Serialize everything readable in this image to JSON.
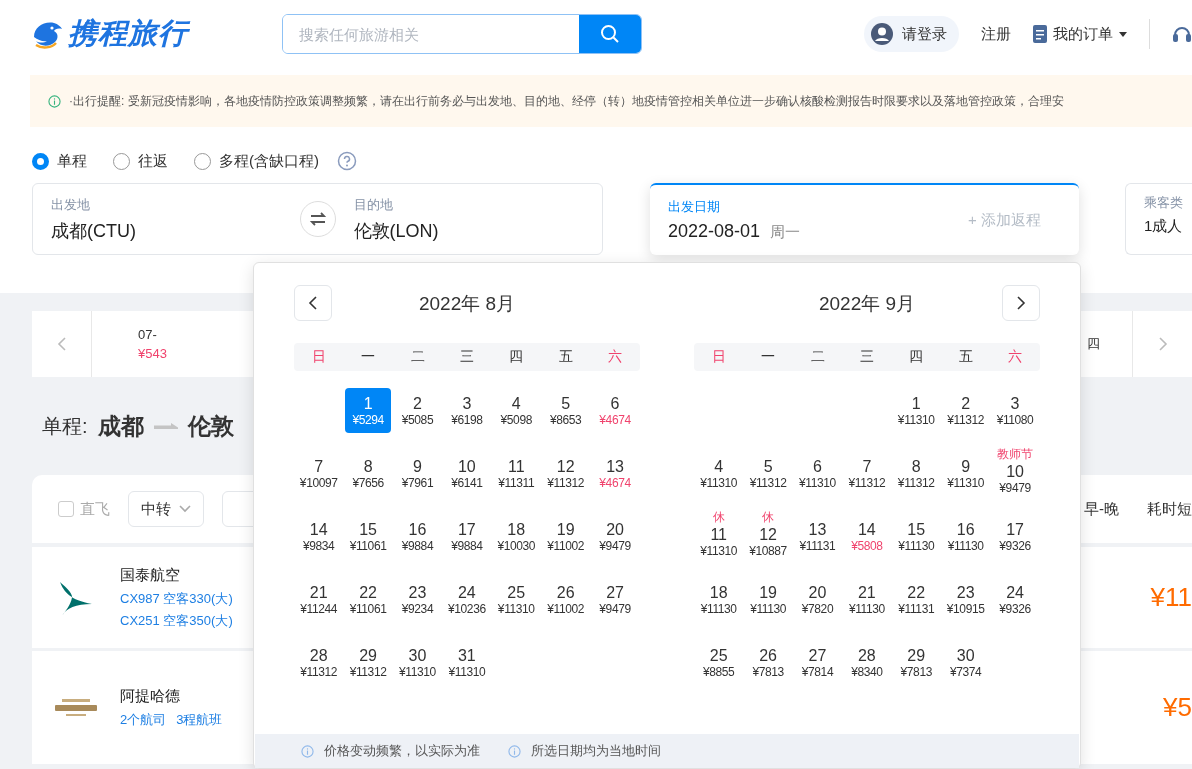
{
  "header": {
    "logo": "携程旅行",
    "search": {
      "placeholder": "搜索任何旅游相关"
    },
    "login": "请登录",
    "register": "注册",
    "orders": "我的订单"
  },
  "notice": "·出行提醒: 受新冠疫情影响，各地疫情防控政策调整频繁，请在出行前务必与出发地、目的地、经停（转）地疫情管控相关单位进一步确认核酸检测报告时限要求以及落地管控政策，合理安",
  "trip_types": [
    {
      "label": "单程",
      "selected": true
    },
    {
      "label": "往返",
      "selected": false
    },
    {
      "label": "多程(含缺口程)",
      "selected": false
    }
  ],
  "search_form": {
    "from": {
      "label": "出发地",
      "value": "成都(CTU)"
    },
    "to": {
      "label": "目的地",
      "value": "伦敦(LON)"
    },
    "date": {
      "label": "出发日期",
      "value": "2022-08-01",
      "weekday": "周一",
      "add_return": "+ 添加返程"
    },
    "passenger": {
      "label": "乘客类",
      "value": "1成人"
    }
  },
  "date_strip": {
    "first_date": "07-",
    "first_price": "¥543",
    "last_label": "四"
  },
  "route": {
    "label": "单程:",
    "from": "成都",
    "to": "伦敦"
  },
  "filters": {
    "direct": {
      "label": "直飞",
      "checked": false
    },
    "transfer": "中转",
    "sorts": [
      "早-晚",
      "耗时短"
    ]
  },
  "flights": [
    {
      "airline": "国泰航空",
      "lines": [
        "CX987 空客330(大)",
        "CX251 空客350(大)"
      ],
      "price": "¥11"
    },
    {
      "airline": "阿提哈德",
      "lines": [
        "2个航司",
        "3程航班"
      ],
      "price": "¥5"
    }
  ],
  "calendar": {
    "months": [
      {
        "title": "2022年 8月",
        "has_prev": true,
        "has_next": false,
        "weekdays": [
          "日",
          "一",
          "二",
          "三",
          "四",
          "五",
          "六"
        ],
        "days": [
          {
            "kind": "blank"
          },
          {
            "kind": "day",
            "day": "1",
            "price": "¥5294",
            "low": false,
            "selected": true
          },
          {
            "kind": "day",
            "day": "2",
            "price": "¥5085",
            "low": false,
            "selected": false
          },
          {
            "kind": "day",
            "day": "3",
            "price": "¥6198",
            "low": false,
            "selected": false
          },
          {
            "kind": "day",
            "day": "4",
            "price": "¥5098",
            "low": false,
            "selected": false
          },
          {
            "kind": "day",
            "day": "5",
            "price": "¥8653",
            "low": false,
            "selected": false
          },
          {
            "kind": "day",
            "day": "6",
            "price": "¥4674",
            "low": true,
            "selected": false
          },
          {
            "kind": "day",
            "day": "7",
            "price": "¥10097",
            "low": false,
            "selected": false
          },
          {
            "kind": "day",
            "day": "8",
            "price": "¥7656",
            "low": false,
            "selected": false
          },
          {
            "kind": "day",
            "day": "9",
            "price": "¥7961",
            "low": false,
            "selected": false
          },
          {
            "kind": "day",
            "day": "10",
            "price": "¥6141",
            "low": false,
            "selected": false
          },
          {
            "kind": "day",
            "day": "11",
            "price": "¥11311",
            "low": false,
            "selected": false
          },
          {
            "kind": "day",
            "day": "12",
            "price": "¥11312",
            "low": false,
            "selected": false
          },
          {
            "kind": "day",
            "day": "13",
            "price": "¥4674",
            "low": true,
            "selected": false
          },
          {
            "kind": "day",
            "day": "14",
            "price": "¥9834",
            "low": false,
            "selected": false
          },
          {
            "kind": "day",
            "day": "15",
            "price": "¥11061",
            "low": false,
            "selected": false
          },
          {
            "kind": "day",
            "day": "16",
            "price": "¥9884",
            "low": false,
            "selected": false
          },
          {
            "kind": "day",
            "day": "17",
            "price": "¥9884",
            "low": false,
            "selected": false
          },
          {
            "kind": "day",
            "day": "18",
            "price": "¥10030",
            "low": false,
            "selected": false
          },
          {
            "kind": "day",
            "day": "19",
            "price": "¥11002",
            "low": false,
            "selected": false
          },
          {
            "kind": "day",
            "day": "20",
            "price": "¥9479",
            "low": false,
            "selected": false
          },
          {
            "kind": "day",
            "day": "21",
            "price": "¥11244",
            "low": false,
            "selected": false
          },
          {
            "kind": "day",
            "day": "22",
            "price": "¥11061",
            "low": false,
            "selected": false
          },
          {
            "kind": "day",
            "day": "23",
            "price": "¥9234",
            "low": false,
            "selected": false
          },
          {
            "kind": "day",
            "day": "24",
            "price": "¥10236",
            "low": false,
            "selected": false
          },
          {
            "kind": "day",
            "day": "25",
            "price": "¥11310",
            "low": false,
            "selected": false
          },
          {
            "kind": "day",
            "day": "26",
            "price": "¥11002",
            "low": false,
            "selected": false
          },
          {
            "kind": "day",
            "day": "27",
            "price": "¥9479",
            "low": false,
            "selected": false
          },
          {
            "kind": "day",
            "day": "28",
            "price": "¥11312",
            "low": false,
            "selected": false
          },
          {
            "kind": "day",
            "day": "29",
            "price": "¥11312",
            "low": false,
            "selected": false
          },
          {
            "kind": "day",
            "day": "30",
            "price": "¥11310",
            "low": false,
            "selected": false
          },
          {
            "kind": "day",
            "day": "31",
            "price": "¥11310",
            "low": false,
            "selected": false
          }
        ]
      },
      {
        "title": "2022年 9月",
        "has_prev": false,
        "has_next": true,
        "weekdays": [
          "日",
          "一",
          "二",
          "三",
          "四",
          "五",
          "六"
        ],
        "days": [
          {
            "kind": "blank"
          },
          {
            "kind": "blank"
          },
          {
            "kind": "blank"
          },
          {
            "kind": "blank"
          },
          {
            "kind": "day",
            "day": "1",
            "price": "¥11310",
            "low": false,
            "selected": false
          },
          {
            "kind": "day",
            "day": "2",
            "price": "¥11312",
            "low": false,
            "selected": false
          },
          {
            "kind": "day",
            "day": "3",
            "price": "¥11080",
            "low": false,
            "selected": false
          },
          {
            "kind": "day",
            "day": "4",
            "price": "¥11310",
            "low": false,
            "selected": false
          },
          {
            "kind": "day",
            "day": "5",
            "price": "¥11312",
            "low": false,
            "selected": false
          },
          {
            "kind": "day",
            "day": "6",
            "price": "¥11310",
            "low": false,
            "selected": false
          },
          {
            "kind": "day",
            "day": "7",
            "price": "¥11312",
            "low": false,
            "selected": false
          },
          {
            "kind": "day",
            "day": "8",
            "price": "¥11312",
            "low": false,
            "selected": false
          },
          {
            "kind": "day",
            "day": "9",
            "price": "¥11310",
            "low": false,
            "selected": false
          },
          {
            "kind": "day",
            "day": "10",
            "price": "¥9479",
            "low": false,
            "selected": false,
            "holiday": "教师节"
          },
          {
            "kind": "day",
            "day": "11",
            "price": "¥11310",
            "low": false,
            "selected": false,
            "holiday": "休"
          },
          {
            "kind": "day",
            "day": "12",
            "price": "¥10887",
            "low": false,
            "selected": false,
            "holiday": "休"
          },
          {
            "kind": "day",
            "day": "13",
            "price": "¥11131",
            "low": false,
            "selected": false
          },
          {
            "kind": "day",
            "day": "14",
            "price": "¥5808",
            "low": true,
            "selected": false
          },
          {
            "kind": "day",
            "day": "15",
            "price": "¥11130",
            "low": false,
            "selected": false
          },
          {
            "kind": "day",
            "day": "16",
            "price": "¥11130",
            "low": false,
            "selected": false
          },
          {
            "kind": "day",
            "day": "17",
            "price": "¥9326",
            "low": false,
            "selected": false
          },
          {
            "kind": "day",
            "day": "18",
            "price": "¥11130",
            "low": false,
            "selected": false
          },
          {
            "kind": "day",
            "day": "19",
            "price": "¥11130",
            "low": false,
            "selected": false
          },
          {
            "kind": "day",
            "day": "20",
            "price": "¥7820",
            "low": false,
            "selected": false
          },
          {
            "kind": "day",
            "day": "21",
            "price": "¥11130",
            "low": false,
            "selected": false
          },
          {
            "kind": "day",
            "day": "22",
            "price": "¥11131",
            "low": false,
            "selected": false
          },
          {
            "kind": "day",
            "day": "23",
            "price": "¥10915",
            "low": false,
            "selected": false
          },
          {
            "kind": "day",
            "day": "24",
            "price": "¥9326",
            "low": false,
            "selected": false
          },
          {
            "kind": "day",
            "day": "25",
            "price": "¥8855",
            "low": false,
            "selected": false
          },
          {
            "kind": "day",
            "day": "26",
            "price": "¥7813",
            "low": false,
            "selected": false
          },
          {
            "kind": "day",
            "day": "27",
            "price": "¥7814",
            "low": false,
            "selected": false
          },
          {
            "kind": "day",
            "day": "28",
            "price": "¥8340",
            "low": false,
            "selected": false
          },
          {
            "kind": "day",
            "day": "29",
            "price": "¥7813",
            "low": false,
            "selected": false
          },
          {
            "kind": "day",
            "day": "30",
            "price": "¥7374",
            "low": false,
            "selected": false
          }
        ]
      }
    ],
    "notes": [
      "价格变动频繁，以实际为准",
      "所选日期均为当地时间"
    ]
  }
}
